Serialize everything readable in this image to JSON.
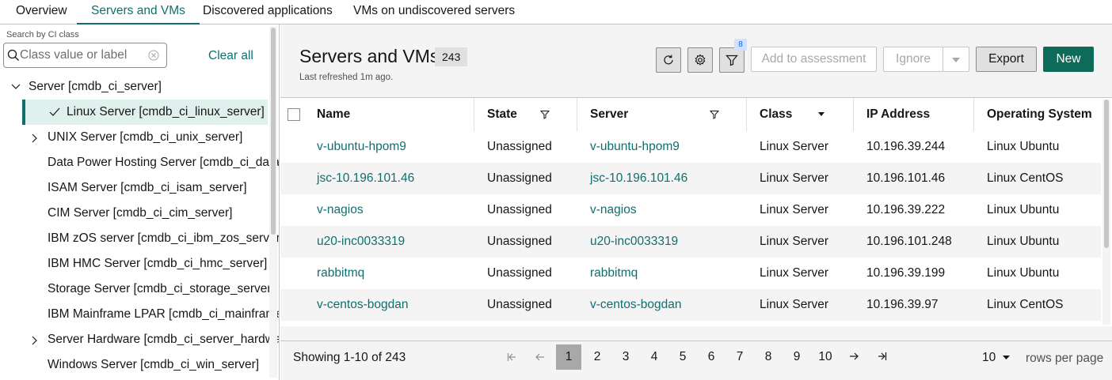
{
  "tabs": [
    "Overview",
    "Servers and VMs",
    "Discovered applications",
    "VMs on undiscovered servers"
  ],
  "active_tab": "Servers and VMs",
  "sidebar": {
    "search_label": "Search by CI class",
    "search_placeholder": "Class value or label",
    "clear_all": "Clear all",
    "tree": [
      {
        "label": "Server [cmdb_ci_server]",
        "expander": "chevron-down"
      },
      {
        "label": "Linux Server [cmdb_ci_linux_server]",
        "selected": true
      },
      {
        "label": "UNIX Server [cmdb_ci_unix_server]",
        "expander": "chevron-right"
      },
      {
        "label": "Data Power Hosting Server [cmdb_ci_datapower_server]"
      },
      {
        "label": "ISAM Server [cmdb_ci_isam_server]"
      },
      {
        "label": "CIM Server [cmdb_ci_cim_server]"
      },
      {
        "label": "IBM zOS server [cmdb_ci_ibm_zos_server]"
      },
      {
        "label": "IBM HMC Server [cmdb_ci_hmc_server]"
      },
      {
        "label": "Storage Server [cmdb_ci_storage_server]"
      },
      {
        "label": "IBM Mainframe LPAR [cmdb_ci_mainframe_lpar]"
      },
      {
        "label": "Server Hardware [cmdb_ci_server_hardware]",
        "expander": "chevron-right"
      },
      {
        "label": "Windows Server [cmdb_ci_win_server]"
      }
    ]
  },
  "main": {
    "title": "Servers and VMs",
    "count": "243",
    "last_refreshed": "Last refreshed 1m ago.",
    "filter_count": "8",
    "buttons": {
      "add_to_assessment": "Add to assessment",
      "ignore": "Ignore",
      "export": "Export",
      "new": "New"
    },
    "columns": [
      "Name",
      "State",
      "Server",
      "Class",
      "IP Address",
      "Operating System"
    ],
    "rows": [
      {
        "name": "v-ubuntu-hpom9",
        "state": "Unassigned",
        "server": "v-ubuntu-hpom9",
        "class": "Linux Server",
        "ip": "10.196.39.244",
        "os": "Linux Ubuntu"
      },
      {
        "name": "jsc-10.196.101.46",
        "state": "Unassigned",
        "server": "jsc-10.196.101.46",
        "class": "Linux Server",
        "ip": "10.196.101.46",
        "os": "Linux CentOS"
      },
      {
        "name": "v-nagios",
        "state": "Unassigned",
        "server": "v-nagios",
        "class": "Linux Server",
        "ip": "10.196.39.222",
        "os": "Linux Ubuntu"
      },
      {
        "name": "u20-inc0033319",
        "state": "Unassigned",
        "server": "u20-inc0033319",
        "class": "Linux Server",
        "ip": "10.196.101.248",
        "os": "Linux Ubuntu"
      },
      {
        "name": "rabbitmq",
        "state": "Unassigned",
        "server": "rabbitmq",
        "class": "Linux Server",
        "ip": "10.196.39.199",
        "os": "Linux Ubuntu"
      },
      {
        "name": "v-centos-bogdan",
        "state": "Unassigned",
        "server": "v-centos-bogdan",
        "class": "Linux Server",
        "ip": "10.196.39.97",
        "os": "Linux CentOS"
      }
    ]
  },
  "pagination": {
    "showing": "Showing 1-10 of 243",
    "pages": [
      "1",
      "2",
      "3",
      "4",
      "5",
      "6",
      "7",
      "8",
      "9",
      "10"
    ],
    "current_page": "1",
    "rows_per_page": "10",
    "rows_per_page_label": "rows per page"
  },
  "colors": {
    "accent": "#0f6f6f",
    "primary_button": "#0e6b5a",
    "selected_tree_bg": "#e0f0ec"
  }
}
